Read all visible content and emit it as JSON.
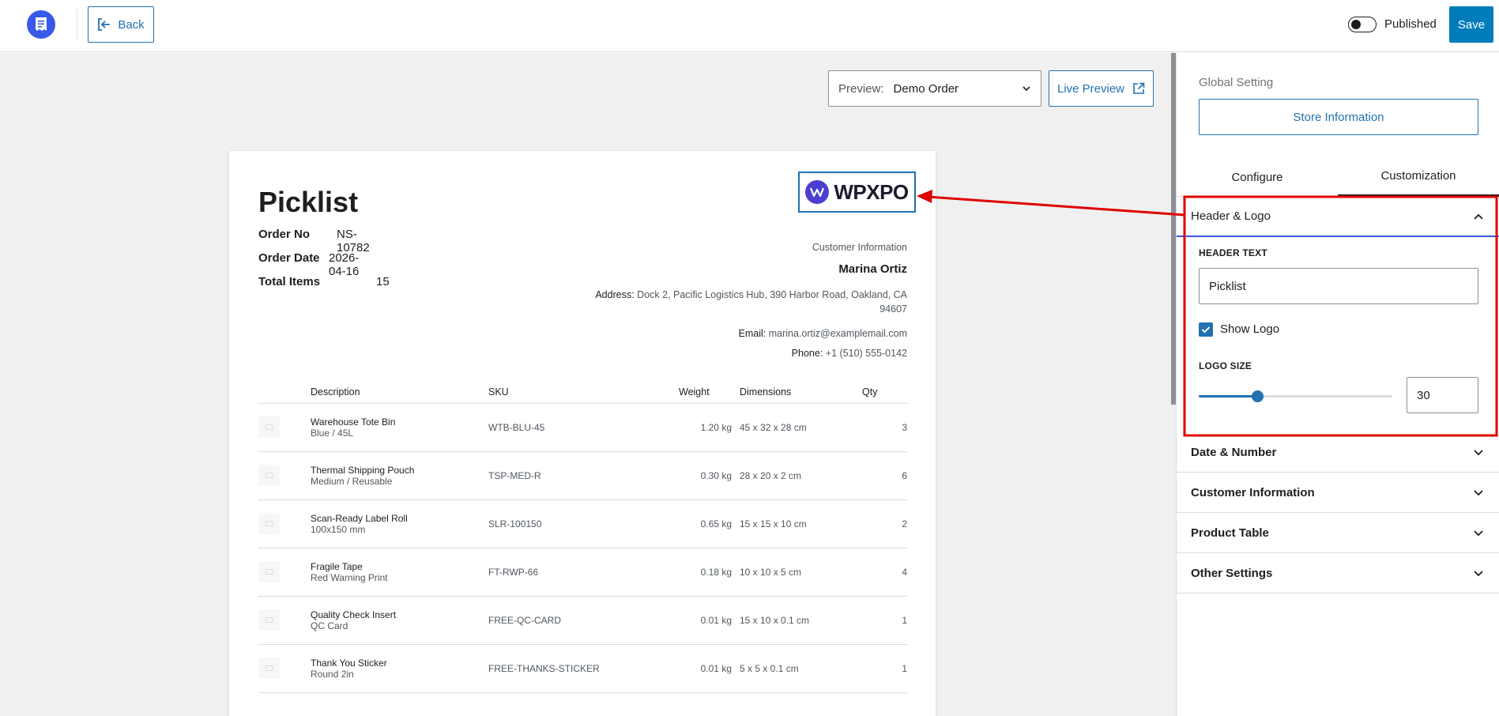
{
  "topbar": {
    "back_label": "Back",
    "published_label": "Published",
    "published_on": false,
    "save_label": "Save"
  },
  "canvas": {
    "preview_label": "Preview:",
    "preview_value": "Demo Order",
    "live_preview_label": "Live Preview"
  },
  "document": {
    "title": "Picklist",
    "logo_text": "WPXPO",
    "order": [
      {
        "label": "Order No",
        "value": "NS-10782"
      },
      {
        "label": "Order Date",
        "value": "2026-04-16"
      },
      {
        "label": "Total Items",
        "value": "15"
      }
    ],
    "customer": {
      "heading": "Customer Information",
      "name": "Marina Ortiz",
      "address_label": "Address:",
      "address_line1": "Dock 2, Pacific Logistics Hub, 390 Harbor Road, Oakland, CA",
      "address_line2": "94607",
      "email_label": "Email:",
      "email": "marina.ortiz@examplemail.com",
      "phone_label": "Phone:",
      "phone": "+1 (510) 555-0142"
    },
    "table": {
      "headers": {
        "description": "Description",
        "sku": "SKU",
        "weight": "Weight",
        "dimensions": "Dimensions",
        "qty": "Qty"
      },
      "rows": [
        {
          "name": "Warehouse Tote Bin",
          "variant": "Blue / 45L",
          "sku": "WTB-BLU-45",
          "weight": "1.20 kg",
          "dimensions": "45 x 32 x 28 cm",
          "qty": "3"
        },
        {
          "name": "Thermal Shipping Pouch",
          "variant": "Medium / Reusable",
          "sku": "TSP-MED-R",
          "weight": "0.30 kg",
          "dimensions": "28 x 20 x 2 cm",
          "qty": "6"
        },
        {
          "name": "Scan-Ready Label Roll",
          "variant": "100x150 mm",
          "sku": "SLR-100150",
          "weight": "0.65 kg",
          "dimensions": "15 x 15 x 10 cm",
          "qty": "2"
        },
        {
          "name": "Fragile Tape",
          "variant": "Red Warning Print",
          "sku": "FT-RWP-66",
          "weight": "0.18 kg",
          "dimensions": "10 x 10 x 5 cm",
          "qty": "4"
        },
        {
          "name": "Quality Check Insert",
          "variant": "QC Card",
          "sku": "FREE-QC-CARD",
          "weight": "0.01 kg",
          "dimensions": "15 x 10 x 0.1 cm",
          "qty": "1"
        },
        {
          "name": "Thank You Sticker",
          "variant": "Round 2in",
          "sku": "FREE-THANKS-STICKER",
          "weight": "0.01 kg",
          "dimensions": "5 x 5 x 0.1 cm",
          "qty": "1"
        }
      ]
    }
  },
  "panel": {
    "global_setting_label": "Global Setting",
    "store_info_label": "Store Information",
    "tabs": [
      {
        "label": "Configure",
        "active": false
      },
      {
        "label": "Customization",
        "active": true
      }
    ],
    "header_logo": {
      "title": "Header & Logo",
      "header_text_label": "HEADER TEXT",
      "header_text_value": "Picklist",
      "show_logo_label": "Show Logo",
      "show_logo_checked": true,
      "logo_size_label": "LOGO SIZE",
      "logo_size_value": "30",
      "logo_size_fraction": 0.3
    },
    "sections": [
      {
        "title": "Date & Number"
      },
      {
        "title": "Customer Information"
      },
      {
        "title": "Product Table"
      },
      {
        "title": "Other Settings"
      }
    ]
  },
  "colors": {
    "accent": "#2271b1",
    "primary": "#007cba",
    "highlight": "#e00000",
    "brand": "#3858e9"
  }
}
